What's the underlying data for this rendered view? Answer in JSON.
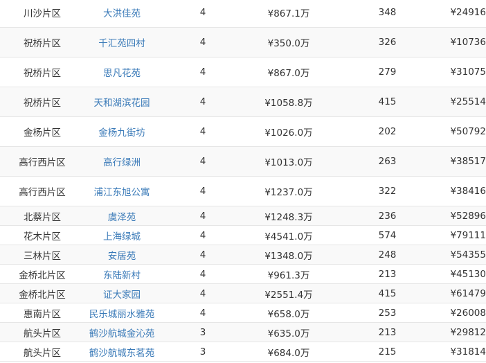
{
  "columns": [
    "area",
    "community",
    "rooms",
    "total_price",
    "count",
    "unit_price"
  ],
  "rows": [
    {
      "area": "川沙片区",
      "community": "大洪佳苑",
      "rooms": "4",
      "total_price": "¥867.1万",
      "count": "348",
      "unit_price": "¥24916"
    },
    {
      "area": "祝桥片区",
      "community": "千汇苑四村",
      "rooms": "4",
      "total_price": "¥350.0万",
      "count": "326",
      "unit_price": "¥10736"
    },
    {
      "area": "祝桥片区",
      "community": "思凡花苑",
      "rooms": "4",
      "total_price": "¥867.0万",
      "count": "279",
      "unit_price": "¥31075"
    },
    {
      "area": "祝桥片区",
      "community": "天和湖滨花园",
      "rooms": "4",
      "total_price": "¥1058.8万",
      "count": "415",
      "unit_price": "¥25514"
    },
    {
      "area": "金杨片区",
      "community": "金杨九街坊",
      "rooms": "4",
      "total_price": "¥1026.0万",
      "count": "202",
      "unit_price": "¥50792"
    },
    {
      "area": "高行西片区",
      "community": "高行绿洲",
      "rooms": "4",
      "total_price": "¥1013.0万",
      "count": "263",
      "unit_price": "¥38517"
    },
    {
      "area": "高行西片区",
      "community": "浦江东旭公寓",
      "rooms": "4",
      "total_price": "¥1237.0万",
      "count": "322",
      "unit_price": "¥38416"
    },
    {
      "area": "北蔡片区",
      "community": "虞泽苑",
      "rooms": "4",
      "total_price": "¥1248.3万",
      "count": "236",
      "unit_price": "¥52896"
    },
    {
      "area": "花木片区",
      "community": "上海绿城",
      "rooms": "4",
      "total_price": "¥4541.0万",
      "count": "574",
      "unit_price": "¥79111"
    },
    {
      "area": "三林片区",
      "community": "安居苑",
      "rooms": "4",
      "total_price": "¥1348.0万",
      "count": "248",
      "unit_price": "¥54355"
    },
    {
      "area": "金桥北片区",
      "community": "东陆新村",
      "rooms": "4",
      "total_price": "¥961.3万",
      "count": "213",
      "unit_price": "¥45130"
    },
    {
      "area": "金桥北片区",
      "community": "证大家园",
      "rooms": "4",
      "total_price": "¥2551.4万",
      "count": "415",
      "unit_price": "¥61479"
    },
    {
      "area": "惠南片区",
      "community": "民乐城丽水雅苑",
      "rooms": "4",
      "total_price": "¥658.0万",
      "count": "253",
      "unit_price": "¥26008"
    },
    {
      "area": "航头片区",
      "community": "鹤沙航城金沁苑",
      "rooms": "3",
      "total_price": "¥635.0万",
      "count": "213",
      "unit_price": "¥29812"
    },
    {
      "area": "航头片区",
      "community": "鹤沙航城东茗苑",
      "rooms": "3",
      "total_price": "¥684.0万",
      "count": "215",
      "unit_price": "¥31814"
    }
  ]
}
